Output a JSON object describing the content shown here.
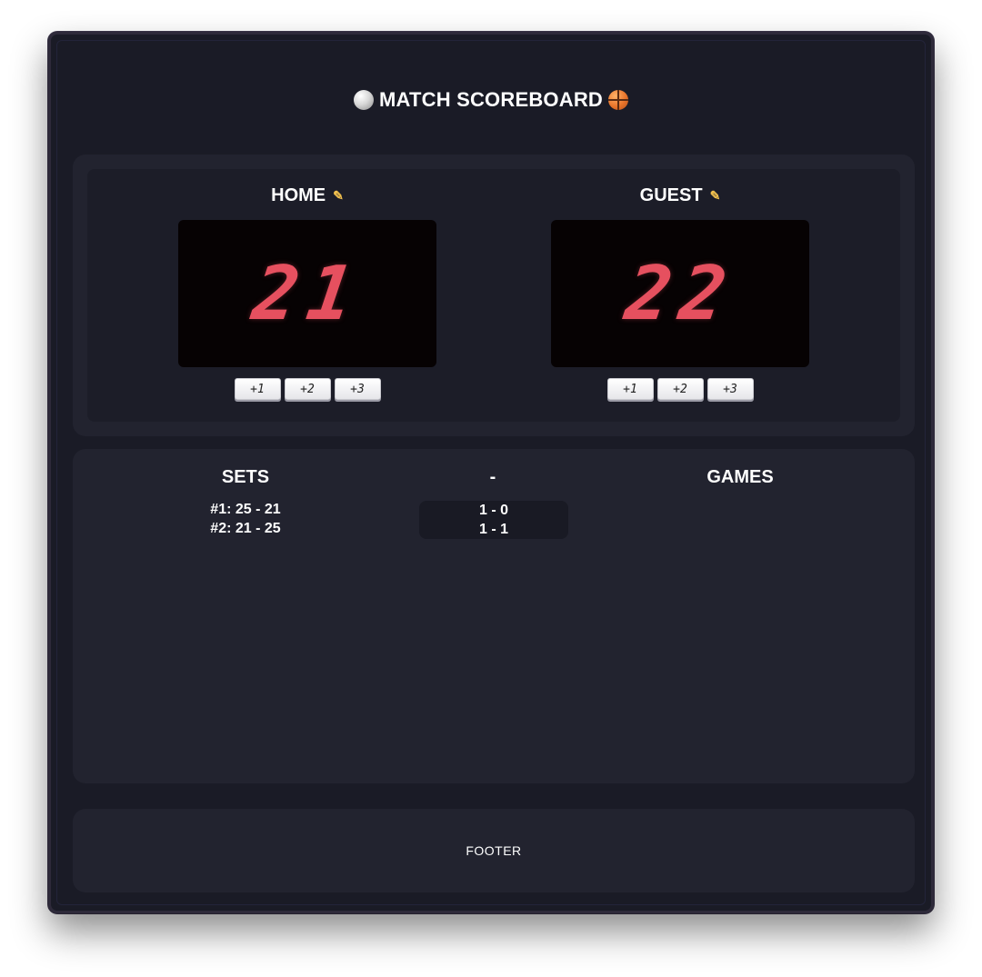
{
  "header": {
    "title": "MATCH SCOREBOARD",
    "left_icon": "volleyball-icon",
    "right_icon": "basketball-icon"
  },
  "home": {
    "name": "HOME",
    "score": "21",
    "buttons": [
      "+1",
      "+2",
      "+3"
    ]
  },
  "guest": {
    "name": "GUEST",
    "score": "22",
    "buttons": [
      "+1",
      "+2",
      "+3"
    ]
  },
  "stats": {
    "sets_label": "SETS",
    "dash_label": "-",
    "games_label": "GAMES",
    "sets": [
      "#1: 25 - 21",
      "#2: 21 - 25"
    ],
    "games": [
      "1 - 0",
      "1 - 1"
    ]
  },
  "footer": {
    "text": "FOOTER"
  },
  "colors": {
    "background": "#1a1b26",
    "panel": "#22232f",
    "digit": "#e6505f"
  }
}
